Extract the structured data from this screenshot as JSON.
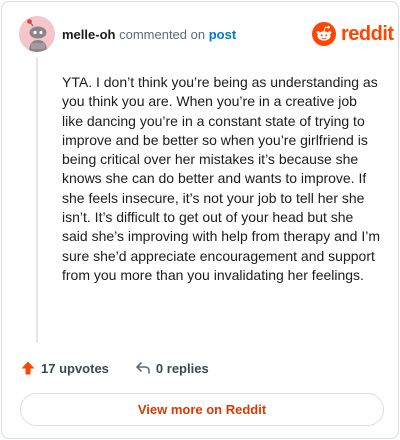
{
  "header": {
    "username": "melle-oh",
    "action_text": "commented on",
    "post_link": "post"
  },
  "brand": {
    "name": "reddit",
    "color": "#ff4500"
  },
  "comment": {
    "text": "YTA. I don’t think you’re being as understanding as you think you are. When you’re in a creative job like dancing you’re in a constant state of trying to improve and be better so when you’re girlfriend is being critical over her mistakes it’s because she knows she can do better and wants to improve. If she feels insecure, it’s not your job to tell her she isn’t. It’s difficult to get out of your head but she said she’s improving with help from therapy and I’m sure she’d appreciate encouragement and support from you more than you invalidating her feelings."
  },
  "footer": {
    "upvotes_label": "17 upvotes",
    "replies_label": "0 replies"
  },
  "view_more": {
    "label": "View more on Reddit"
  },
  "icons": {
    "avatar": "snoo-avatar-icon",
    "brand": "reddit-logo-icon",
    "upvote": "upvote-arrow-icon",
    "reply": "reply-arrow-icon"
  }
}
